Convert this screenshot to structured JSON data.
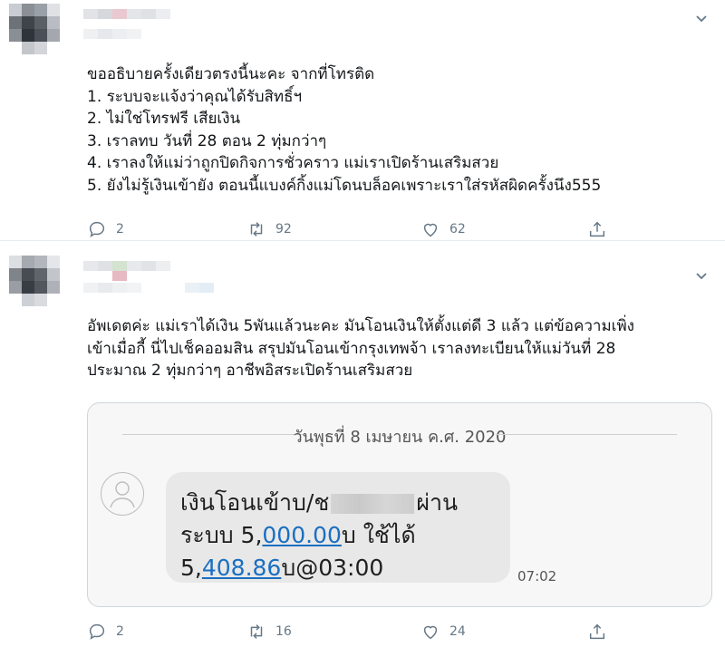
{
  "tweet1": {
    "lines": [
      "ขออธิบายครั้งเดียวตรงนี้นะคะ จากที่โทรติด",
      "1. ระบบจะแจ้งว่าคุณได้รับสิทธิ์ฯ",
      "2. ไม่ใช่โทรฟรี เสียเงิน",
      "3. เราลทบ วันที่ 28 ตอน 2 ทุ่มกว่าๆ",
      "4. เราลงให้แม่ว่าถูกปิดกิจการชั่วคราว แม่เราเปิดร้านเสริมสวย",
      "5. ยังไม่รู้เงินเข้ายัง ตอนนี้แบงค์กิ้งแม่โดนบล็อคเพราะเราใส่รหัสผิดครั้งนึง555"
    ],
    "reply_count": "2",
    "retweet_count": "92",
    "like_count": "62"
  },
  "tweet2": {
    "lines": [
      "อัพเดตค่ะ แม่เราได้เงิน 5พันแล้วนะคะ มันโอนเงินให้ตั้งแต่ดี 3 แล้ว แต่ข้อความเพิ่ง",
      "เข้าเมื่อกี้ นี่ไปเช็คออมสิน สรุปมันโอนเข้ากรุงเทพจ้า เราลงทะเบียนให้แม่วันที่ 28",
      "ประมาณ 2 ทุ่มกว่าๆ อาชีพอิสระเปิดร้านเสริมสวย"
    ],
    "sms": {
      "date": "วันพุธที่ 8 เมษายน ค.ศ. 2020",
      "line1_a": "เงินโอนเข้าบ/ช",
      "line1_b": "ผ่าน",
      "line2_a": "ระบบ 5,",
      "line2_link": "000.00",
      "line2_b": "บ ใช้ได้",
      "line3_a": "5,",
      "line3_link": "408.86",
      "line3_b": "บ@03:00",
      "time": "07:02"
    },
    "reply_count": "2",
    "retweet_count": "16",
    "like_count": "24"
  },
  "icons": {
    "reply": "reply-icon",
    "retweet": "retweet-icon",
    "like": "heart-icon",
    "share": "share-icon",
    "menu": "chevron-down-icon"
  },
  "colors": {
    "icon": "#657786",
    "link": "#1a6fc2",
    "divider": "#e6ecf0"
  }
}
